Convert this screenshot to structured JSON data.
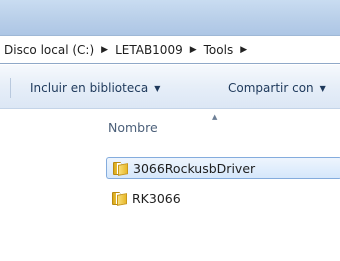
{
  "address_bar": {
    "crumbs": [
      "Disco local (C:)",
      "LETAB1009",
      "Tools"
    ]
  },
  "toolbar": {
    "library_label": "Incluir en biblioteca",
    "share_label": "Compartir con"
  },
  "file_list": {
    "column_name": "Nombre",
    "items": [
      {
        "label": "3066RockusbDriver",
        "selected": true
      },
      {
        "label": "RK3066",
        "selected": false
      }
    ]
  }
}
